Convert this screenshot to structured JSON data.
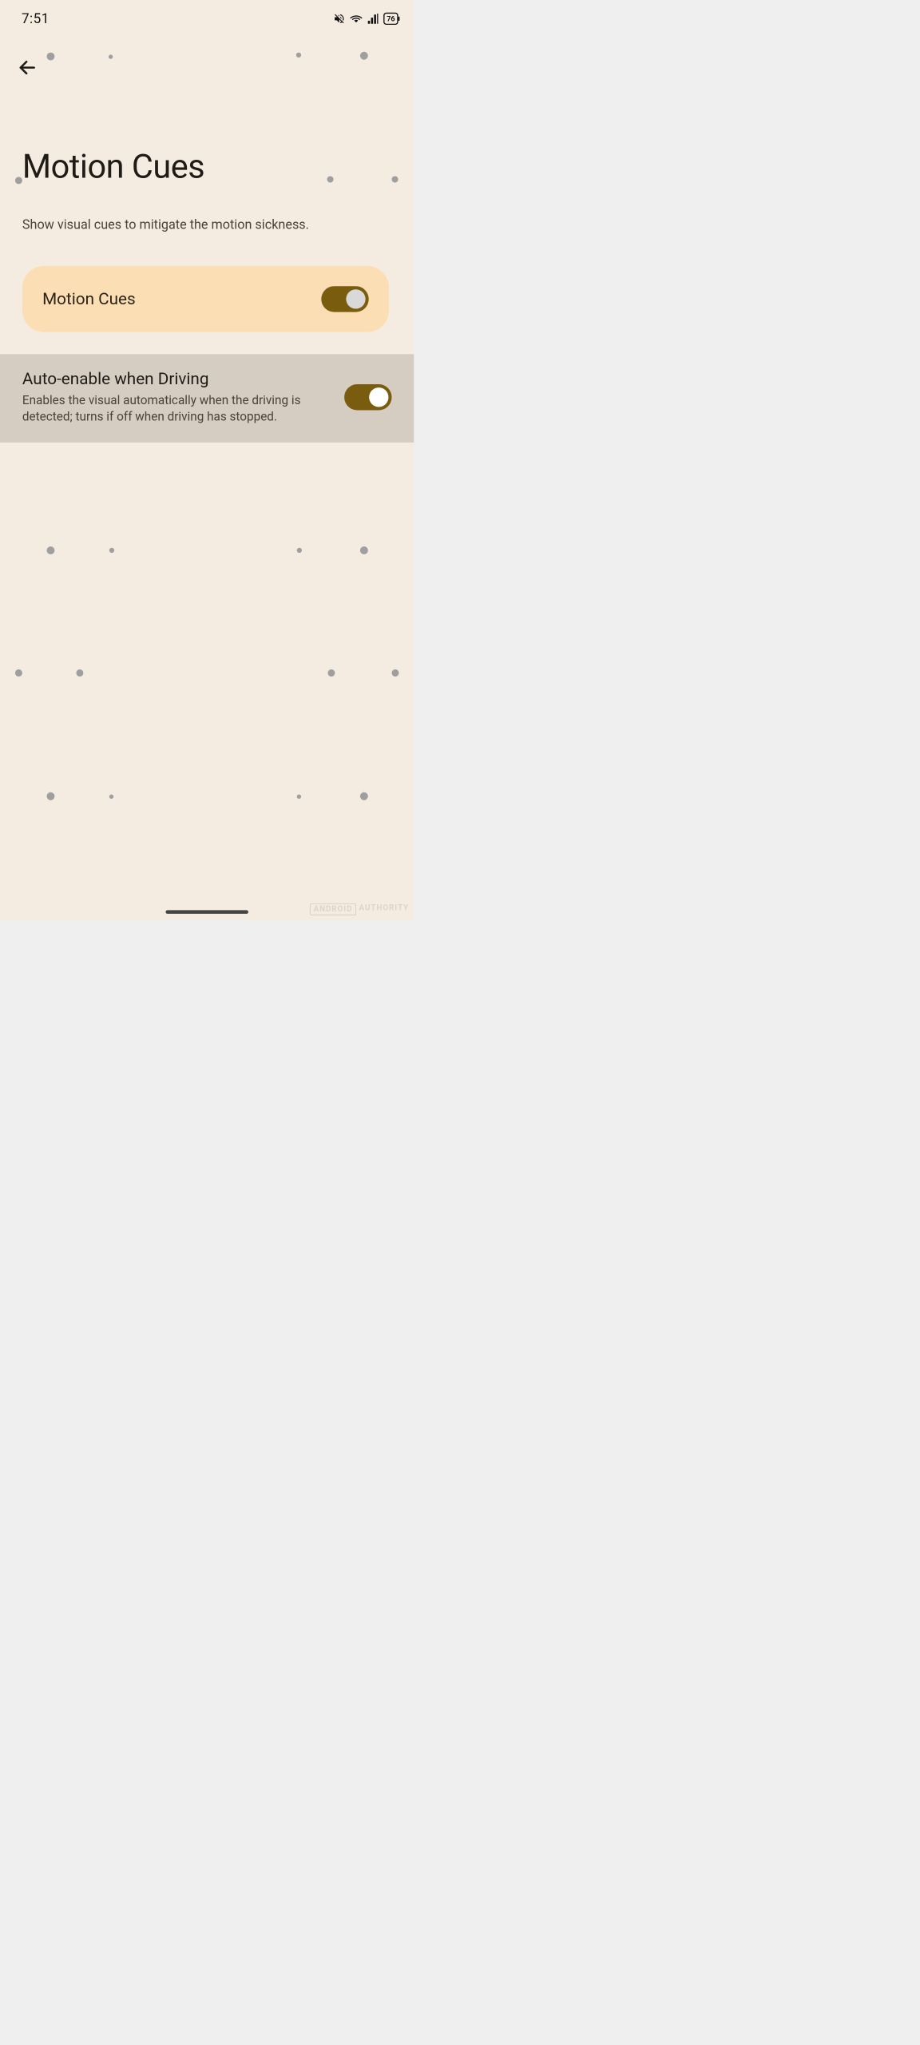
{
  "status": {
    "time": "7:51",
    "battery": "76"
  },
  "header": {
    "title": "Motion Cues",
    "subtitle": "Show visual cues to mitigate the motion sickness."
  },
  "settings": {
    "primary": {
      "label": "Motion Cues",
      "enabled": true
    },
    "auto": {
      "title": "Auto-enable when Driving",
      "description": "Enables the visual automatically when the driving is detected; turns if off when driving has stopped.",
      "enabled": true
    }
  },
  "watermark": {
    "a": "ANDROID",
    "b": "AUTHORITY"
  },
  "colors": {
    "bg": "#f5ece1",
    "card": "#fcdeb4",
    "row": "#d5cdc2",
    "accent": "#7a5c0f"
  }
}
